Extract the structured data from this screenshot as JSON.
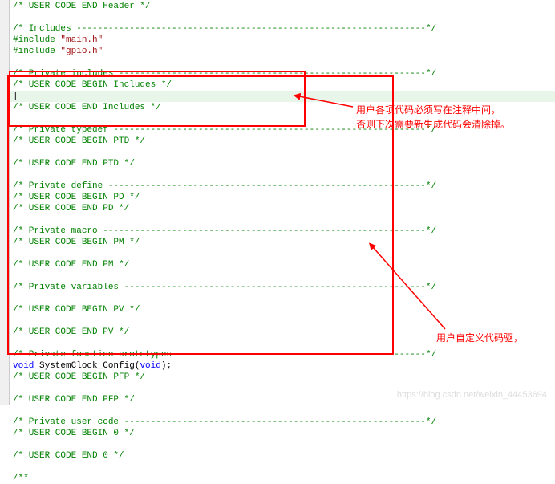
{
  "lines": [
    {
      "cls": "comment",
      "text": "/* USER CODE END Header */"
    },
    {
      "cls": "",
      "text": ""
    },
    {
      "cls": "comment",
      "text": "/* Includes ------------------------------------------------------------------*/"
    },
    {
      "cls": "preproc",
      "text": "#include ",
      "tail": "\"main.h\"",
      "tailCls": "string"
    },
    {
      "cls": "preproc",
      "text": "#include ",
      "tail": "\"gpio.h\"",
      "tailCls": "string"
    },
    {
      "cls": "",
      "text": ""
    },
    {
      "cls": "comment",
      "text": "/* Private includes ----------------------------------------------------------*/"
    },
    {
      "cls": "comment",
      "text": "/* USER CODE BEGIN Includes */"
    },
    {
      "cls": "",
      "text": "",
      "hl": true,
      "cursor": true
    },
    {
      "cls": "comment",
      "text": "/* USER CODE END Includes */"
    },
    {
      "cls": "",
      "text": ""
    },
    {
      "cls": "comment",
      "text": "/* Private typedef -----------------------------------------------------------*/"
    },
    {
      "cls": "comment",
      "text": "/* USER CODE BEGIN PTD */"
    },
    {
      "cls": "",
      "text": ""
    },
    {
      "cls": "comment",
      "text": "/* USER CODE END PTD */"
    },
    {
      "cls": "",
      "text": ""
    },
    {
      "cls": "comment",
      "text": "/* Private define ------------------------------------------------------------*/"
    },
    {
      "cls": "comment",
      "text": "/* USER CODE BEGIN PD */"
    },
    {
      "cls": "comment",
      "text": "/* USER CODE END PD */"
    },
    {
      "cls": "",
      "text": ""
    },
    {
      "cls": "comment",
      "text": "/* Private macro -------------------------------------------------------------*/"
    },
    {
      "cls": "comment",
      "text": "/* USER CODE BEGIN PM */"
    },
    {
      "cls": "",
      "text": ""
    },
    {
      "cls": "comment",
      "text": "/* USER CODE END PM */"
    },
    {
      "cls": "",
      "text": ""
    },
    {
      "cls": "comment",
      "text": "/* Private variables ---------------------------------------------------------*/"
    },
    {
      "cls": "",
      "text": ""
    },
    {
      "cls": "comment",
      "text": "/* USER CODE BEGIN PV */"
    },
    {
      "cls": "",
      "text": ""
    },
    {
      "cls": "comment",
      "text": "/* USER CODE END PV */"
    },
    {
      "cls": "",
      "text": ""
    },
    {
      "cls": "comment",
      "text": "/* Private function prototypes -----------------------------------------------*/"
    },
    {
      "cls": "func",
      "text": "void SystemClock_Config(void);",
      "kw": "void"
    },
    {
      "cls": "comment",
      "text": "/* USER CODE BEGIN PFP */"
    },
    {
      "cls": "",
      "text": ""
    },
    {
      "cls": "comment",
      "text": "/* USER CODE END PFP */"
    },
    {
      "cls": "",
      "text": ""
    },
    {
      "cls": "comment",
      "text": "/* Private user code ---------------------------------------------------------*/"
    },
    {
      "cls": "comment",
      "text": "/* USER CODE BEGIN 0 */"
    },
    {
      "cls": "",
      "text": ""
    },
    {
      "cls": "comment",
      "text": "/* USER CODE END 0 */"
    },
    {
      "cls": "",
      "text": ""
    },
    {
      "cls": "comment",
      "text": "/**"
    }
  ],
  "annotations": {
    "note1_line1": "用户各项代码必须写在注释中间，",
    "note1_line2": "否则下次需要新生成代码会清除掉。",
    "note2": "用户自定义代码驱，"
  },
  "watermark": "https://blog.csdn.net/weixin_44453694"
}
